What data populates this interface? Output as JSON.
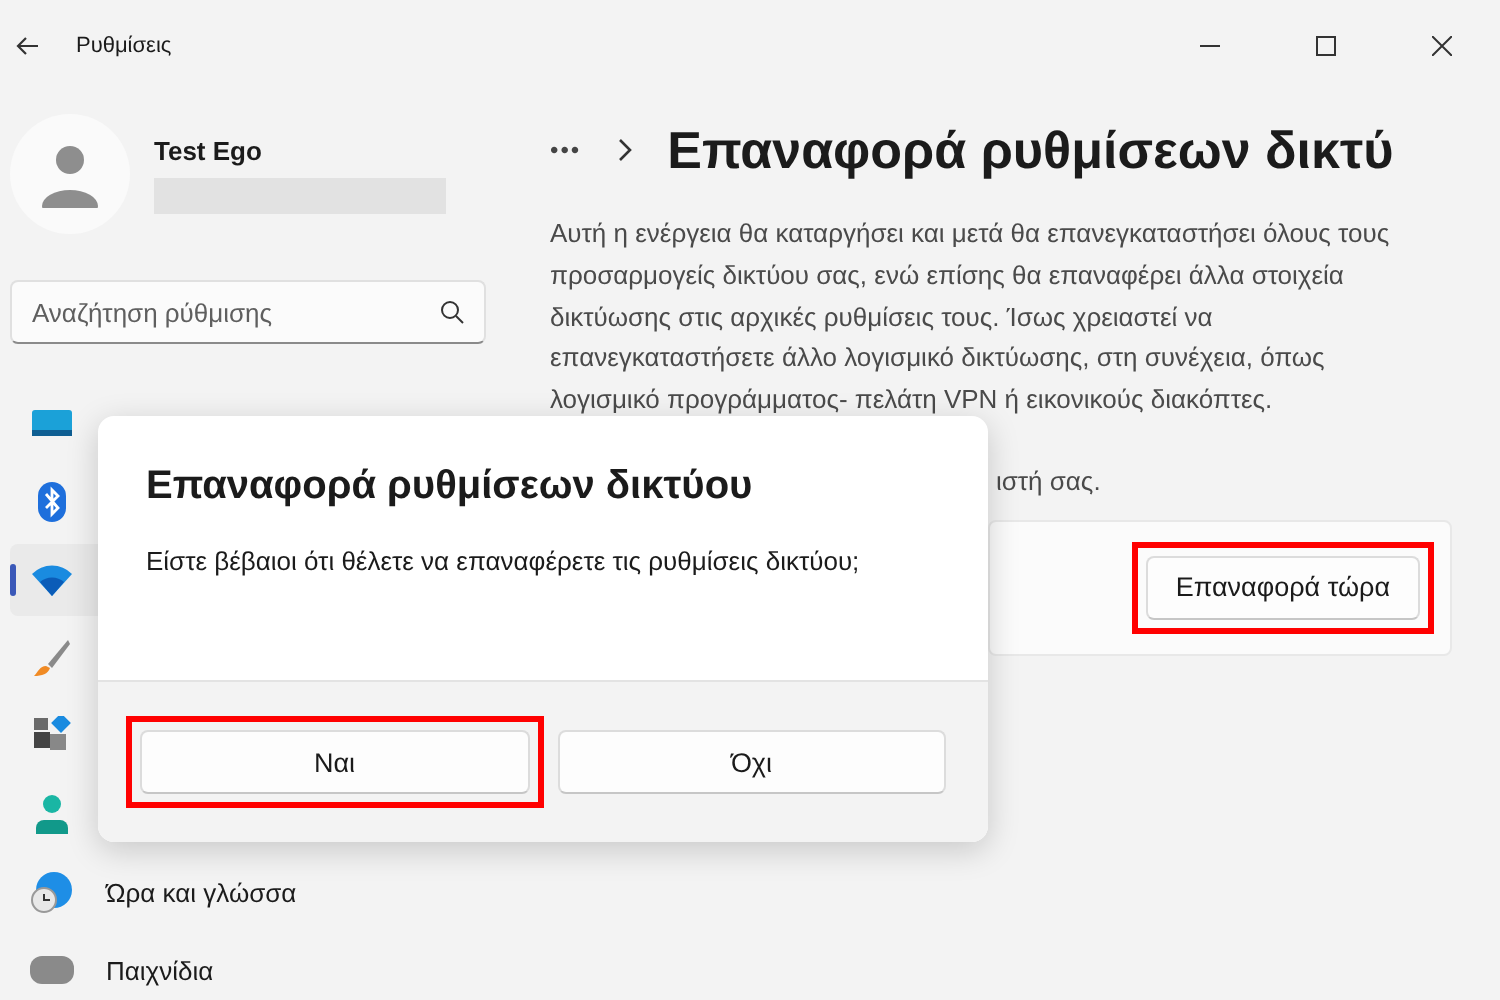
{
  "window": {
    "title": "Ρυθμίσεις"
  },
  "profile": {
    "name": "Test Ego"
  },
  "search": {
    "placeholder": "Αναζήτηση ρύθμισης"
  },
  "sidebar": {
    "items": [
      {
        "kind": "display",
        "selected": false
      },
      {
        "kind": "bluetooth",
        "selected": false
      },
      {
        "kind": "network",
        "selected": true
      },
      {
        "kind": "brush",
        "selected": false
      },
      {
        "kind": "apps",
        "selected": false
      },
      {
        "kind": "accounts",
        "selected": false
      },
      {
        "kind": "time",
        "label": "Ώρα και γλώσσα",
        "selected": false
      },
      {
        "kind": "gaming",
        "label": "Παιχνίδια",
        "selected": false
      }
    ]
  },
  "breadcrumb": {
    "more": "•••",
    "title": "Επαναφορά ρυθμίσεων δικτύ"
  },
  "description": "Αυτή η ενέργεια θα καταργήσει και μετά θα επανεγκαταστήσει όλους τους προσαρμογείς δικτύου σας, ενώ επίσης θα επαναφέρει άλλα στοιχεία δικτύωσης στις αρχικές ρυθμίσεις τους. Ίσως χρειαστεί να επανεγκαταστήσετε άλλο λογισμικό δικτύωσης, στη συνέχεια, όπως λογισμικό προγράμματος- πελάτη VPN ή εικονικούς διακόπτες.",
  "note_fragment": "ιστή σας.",
  "reset_card": {
    "button": {
      "label": "Επαναφορά τώρα",
      "highlighted": true
    }
  },
  "dialog": {
    "title": "Επαναφορά ρυθμίσεων δικτύου",
    "message": "Είστε βέβαιοι ότι θέλετε να επαναφέρετε τις ρυθμίσεις δικτύου;",
    "buttons": [
      {
        "label": "Ναι",
        "highlighted": true
      },
      {
        "label": "Όχι",
        "highlighted": false
      }
    ]
  }
}
